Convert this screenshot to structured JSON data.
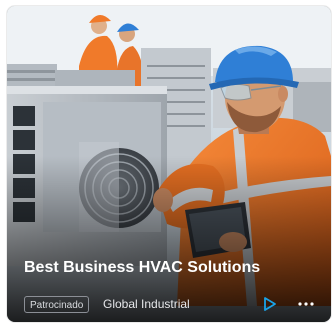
{
  "card": {
    "title": "Best Business HVAC Solutions",
    "sponsored_label": "Patrocinado",
    "advertiser": "Global Industrial"
  },
  "icons": {
    "play": "play-icon",
    "more": "more-options-icon"
  },
  "colors": {
    "accent": "#1aa3e8",
    "vest_orange": "#f07a2a",
    "helmet_blue": "#2f7fd6"
  }
}
